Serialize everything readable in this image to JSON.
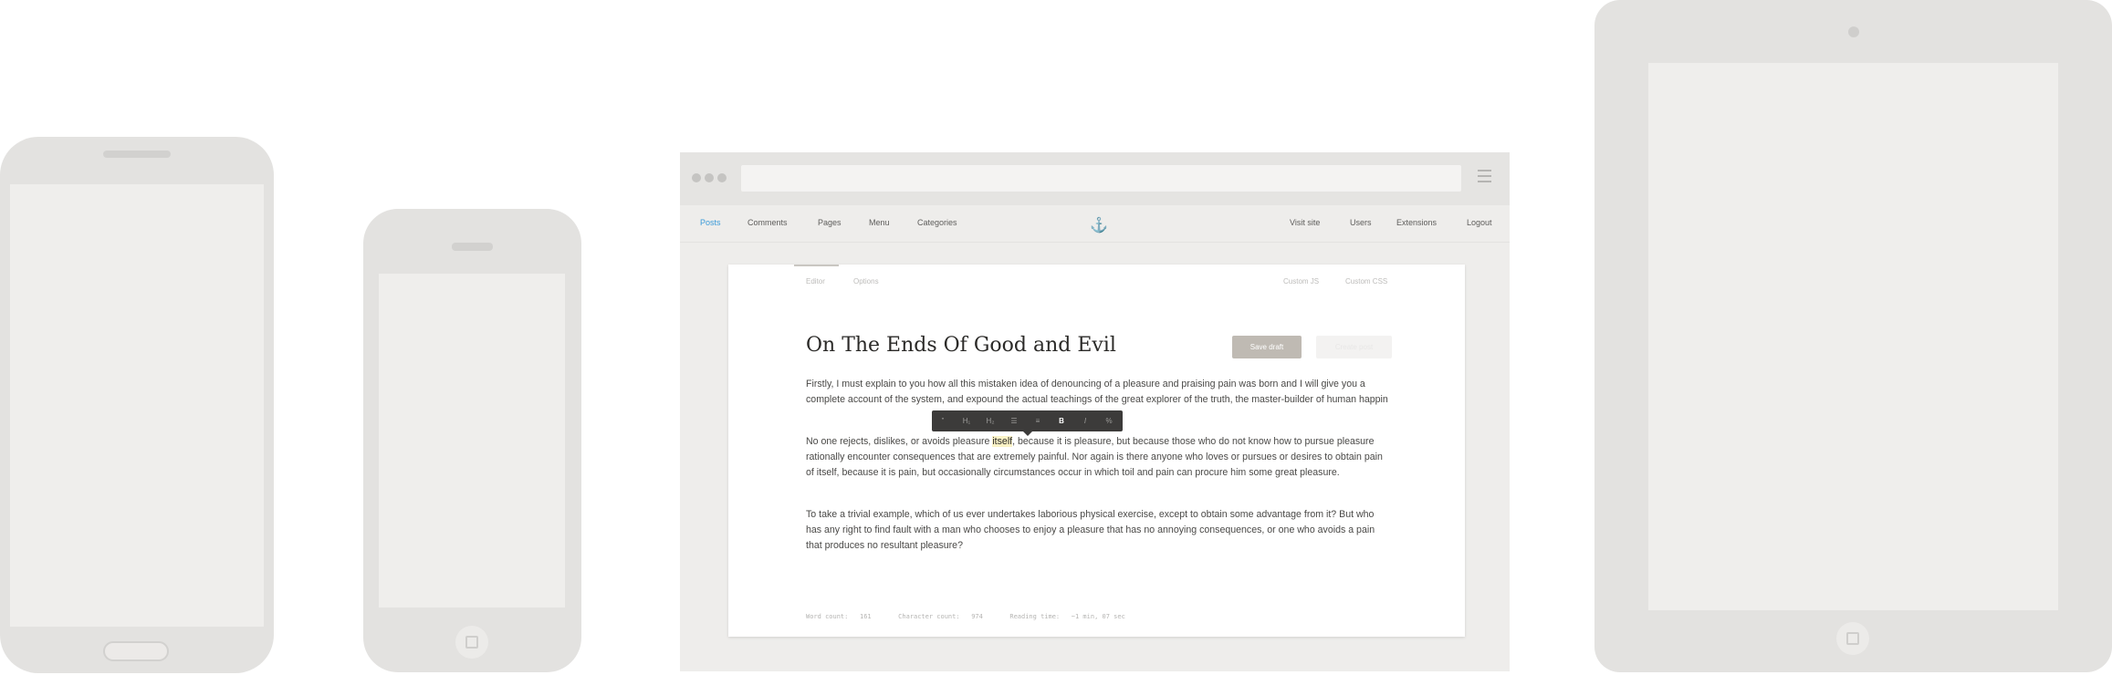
{
  "devices": {
    "android_icon": "android-phone",
    "iphone_icon": "iphone",
    "ipad_icon": "ipad"
  },
  "browser": {
    "nav_left": [
      "Posts",
      "Comments",
      "Pages",
      "Menu",
      "Categories"
    ],
    "nav_right": [
      "Visit site",
      "Users",
      "Extensions",
      "Logout"
    ],
    "active_color": "#3a9ad9"
  },
  "editor": {
    "tabs_left": [
      "Editor",
      "Options"
    ],
    "tabs_right": [
      "Custom JS",
      "Custom CSS"
    ],
    "title": "On The Ends Of Good and Evil",
    "save_label": "Save draft",
    "publish_label": "Create post",
    "p1": "Firstly, I must explain to you how all this mistaken idea of denouncing of a pleasure and praising pain was born and I will give you a complete account of the system, and expound the actual teachings of the great explorer of the truth, the master-builder of human happin",
    "p2_before": "No one rejects, dislikes, or avoids pleasure ",
    "p2_highlight": "itself",
    "p2_after": ", because it is pleasure, but because those who do not know how to pursue pleasure rationally encounter consequences that are extremely painful. Nor again is there anyone who loves or pursues or desires to obtain pain of itself, because it is pain, but occasionally circumstances occur in which toil and pain can procure him some great pleasure.",
    "p3": "To take a trivial example, which of us ever undertakes laborious physical exercise, except to obtain some advantage from it? But who has any right to find fault with a man who chooses to enjoy a pleasure that has no annoying consequences, or one who avoids a pain that produces no resultant pleasure?",
    "format_buttons": [
      "”",
      "H₁",
      "H₂",
      "☰",
      "≡",
      "B",
      "I",
      "%"
    ],
    "stats": "Word count:   161       Character count:   974       Reading time:   ~1 min, 07 sec"
  }
}
